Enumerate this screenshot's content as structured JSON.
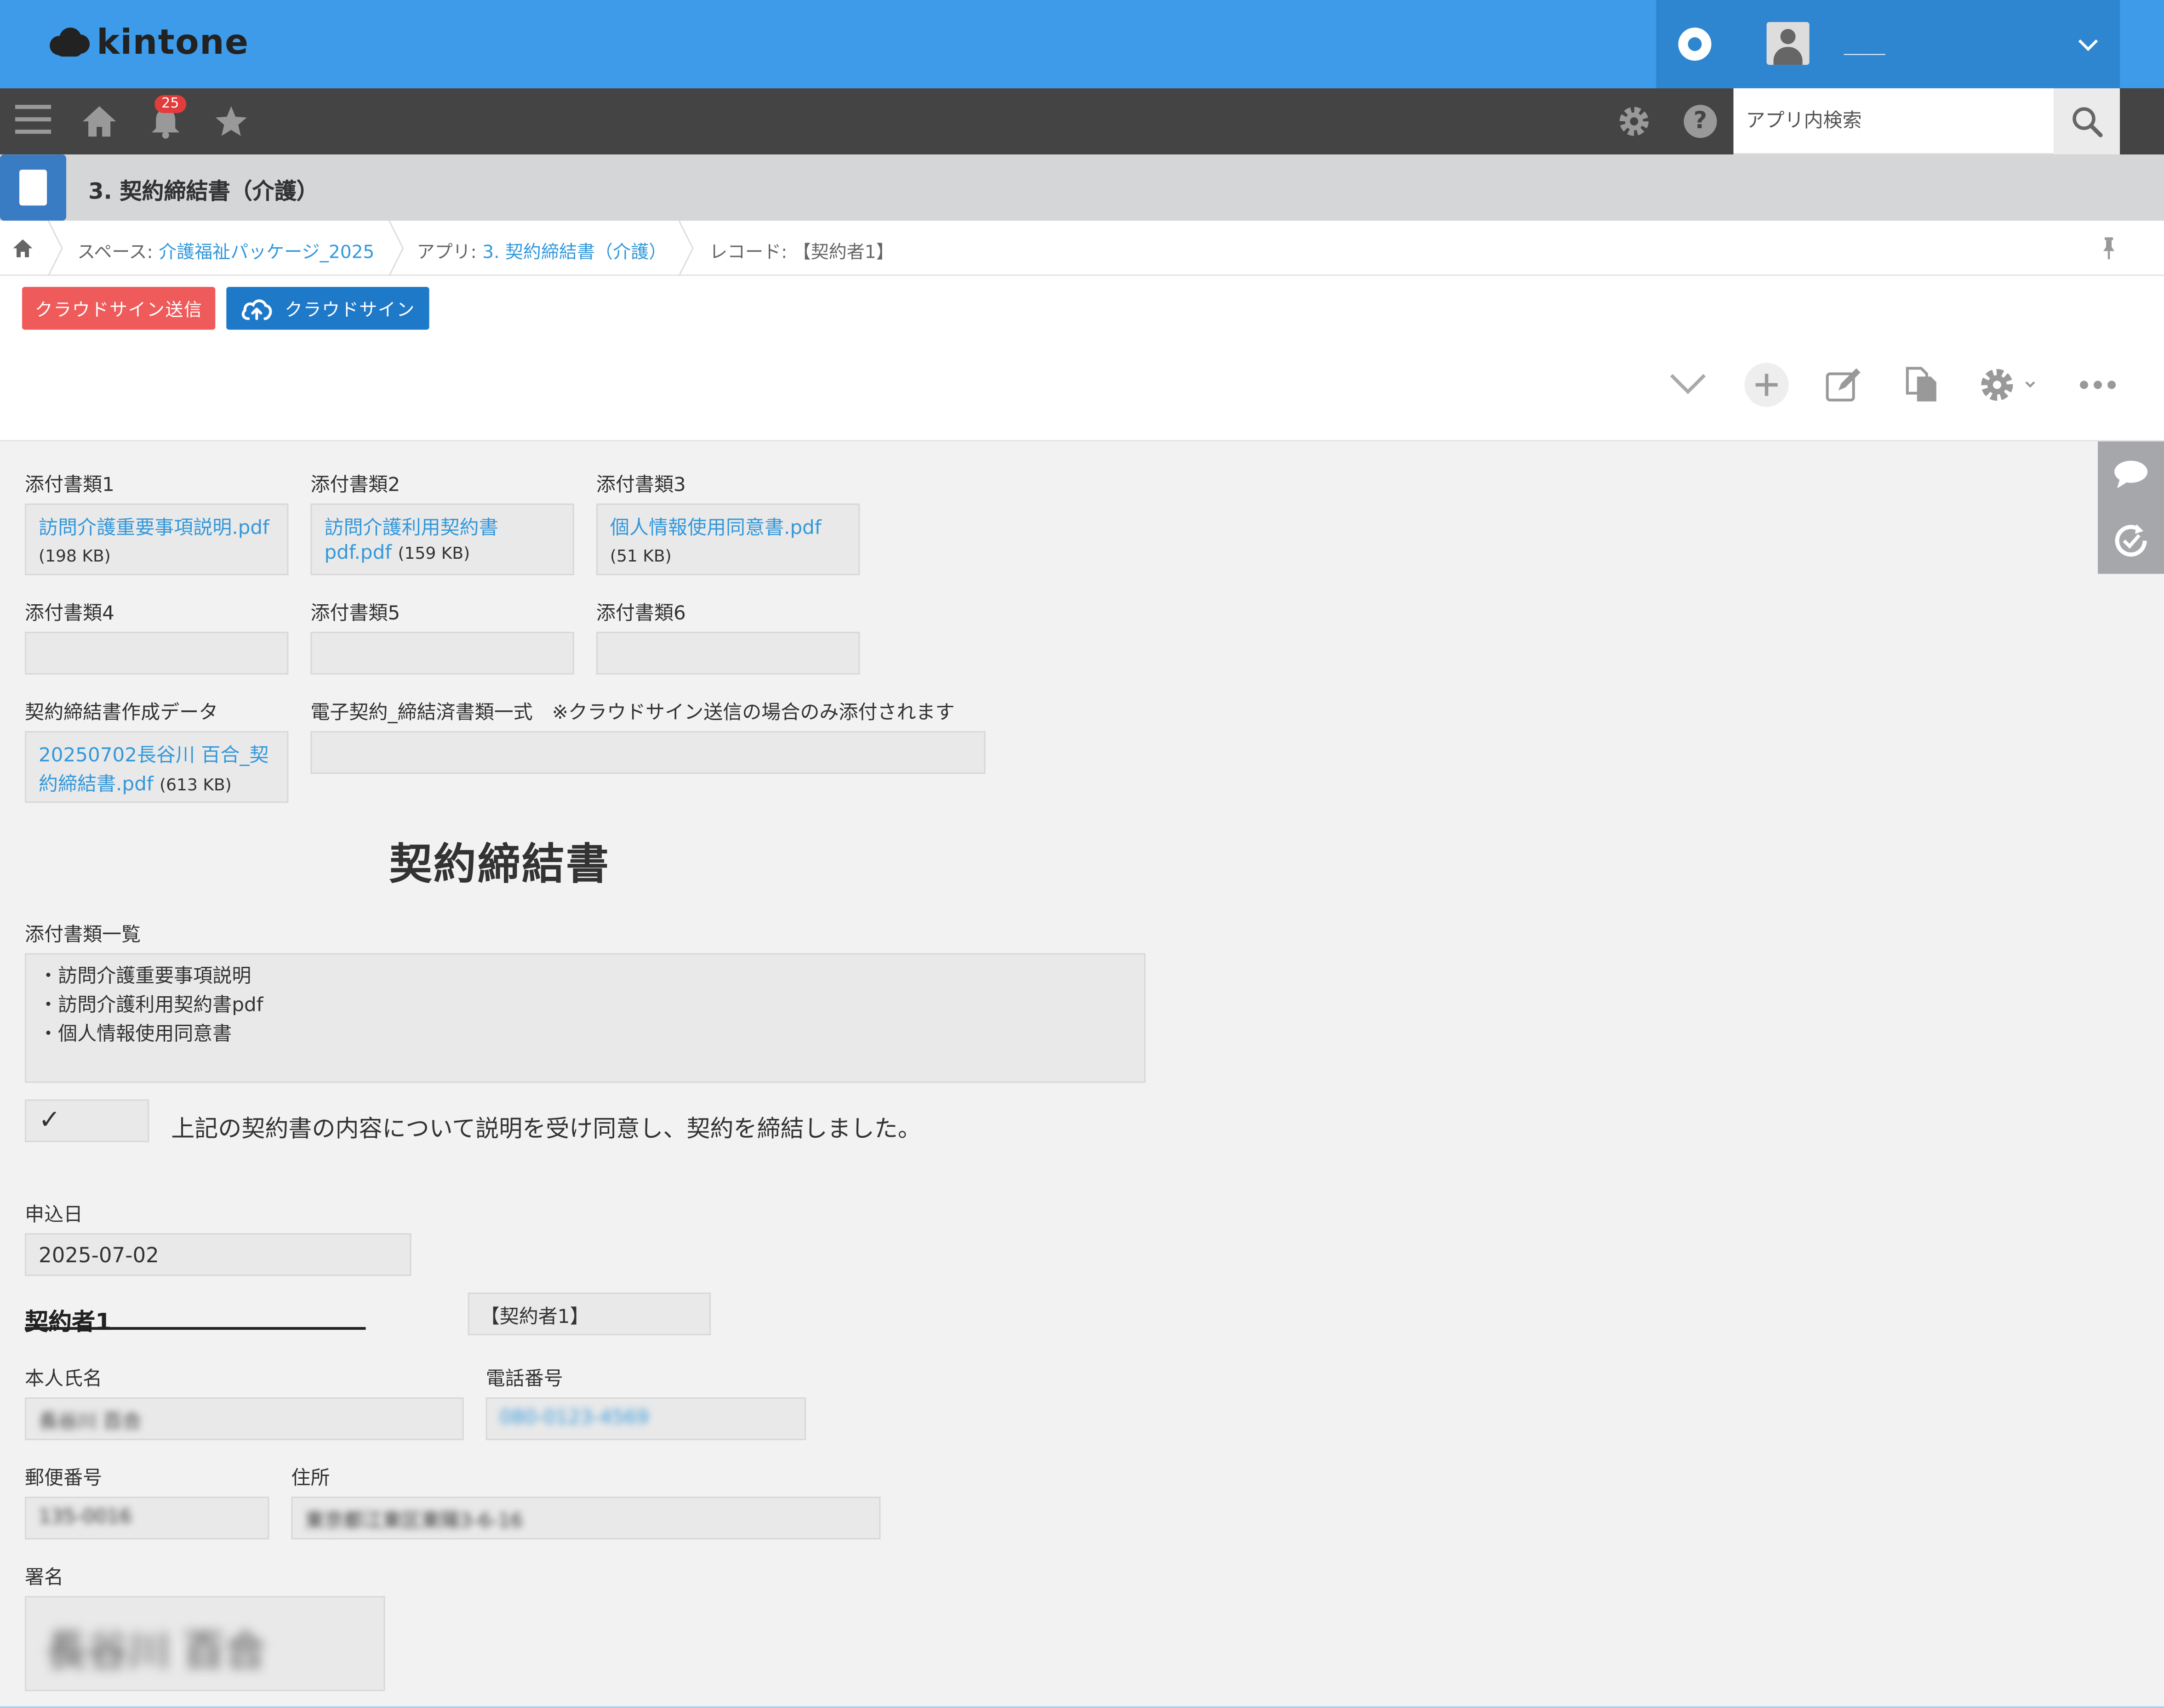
{
  "header": {
    "logo_text": "kintone",
    "user_name": "＿＿"
  },
  "toolbar": {
    "notification_count": "25",
    "search_placeholder": "アプリ内検索"
  },
  "app": {
    "title": "3. 契約締結書（介護）"
  },
  "breadcrumb": {
    "space_prefix": "スペース: ",
    "space_name": "介護福祉パッケージ_2025",
    "app_prefix": "アプリ: ",
    "app_name": "3. 契約締結書（介護）",
    "record_prefix": "レコード: ",
    "record_name": "【契約者1】"
  },
  "actions": {
    "cloudsign_send_label": "クラウドサイン送信",
    "cloudsign_label": "クラウドサイン"
  },
  "attachments": {
    "doc1": {
      "label": "添付書類1",
      "file_name": "訪問介護重要事項説明.pdf",
      "file_size": "(198 KB)"
    },
    "doc2": {
      "label": "添付書類2",
      "file_name_line1": "訪問介護利用契約書",
      "file_name_line2": "pdf.pdf",
      "file_size": "(159 KB)"
    },
    "doc3": {
      "label": "添付書類3",
      "file_name": "個人情報使用同意書.pdf",
      "file_size": "(51 KB)"
    },
    "doc4": {
      "label": "添付書類4"
    },
    "doc5": {
      "label": "添付書類5"
    },
    "doc6": {
      "label": "添付書類6"
    },
    "created_data": {
      "label": "契約締結書作成データ",
      "file_name_line1": "20250702長谷川 百合_契",
      "file_name_line2": "約締結書.pdf",
      "file_size": "(613 KB)"
    },
    "econtract": {
      "label": "電子契約_締結済書類一式　※クラウドサイン送信の場合のみ添付されます"
    }
  },
  "contract": {
    "heading": "契約締結書",
    "doc_list_label": "添付書類一覧",
    "doc_list": [
      "・訪問介護重要事項説明",
      "・訪問介護利用契約書pdf",
      "・個人情報使用同意書"
    ],
    "checkbox_mark": "✓",
    "checkbox_checked": true,
    "agreement_text": "上記の契約書の内容について説明を受け同意し、契約を締結しました。"
  },
  "application_date": {
    "label": "申込日",
    "value": "2025-07-02"
  },
  "contractor": {
    "section_title": "契約者1",
    "tag_value": "【契約者1】",
    "name_label": "本人氏名",
    "name_value": "長谷川 百合",
    "phone_label": "電話番号",
    "phone_value": "080-0123-4569",
    "postal_label": "郵便番号",
    "postal_value": "135-0016",
    "address_label": "住所",
    "address_value": "東京都江東区東陽3-6-16",
    "signature_label": "署名",
    "signature_value": "長谷川 百合"
  },
  "colors": {
    "header_blue": "#3d9be9",
    "toolbar_dark": "#444444",
    "cloudsign_send_red": "#ef5a5a",
    "cloudsign_blue": "#1f79c9",
    "link_blue": "#3498db"
  }
}
